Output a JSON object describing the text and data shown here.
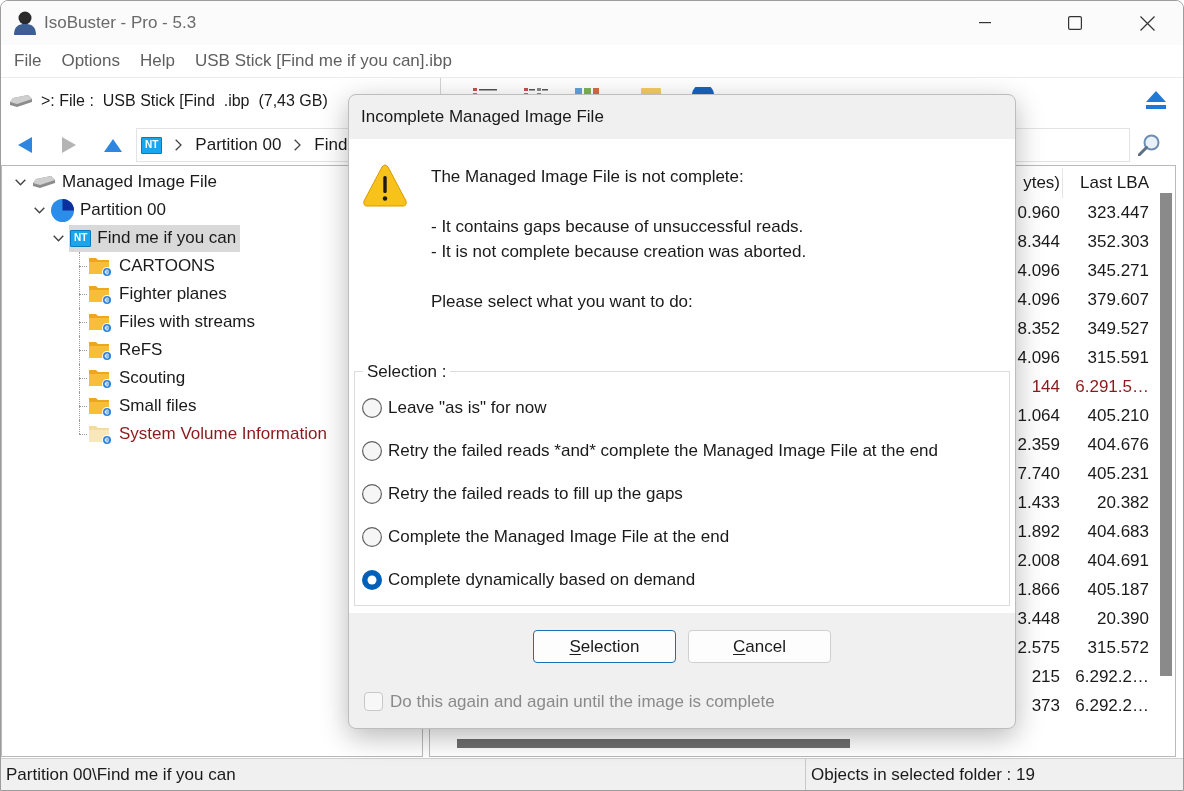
{
  "window": {
    "title": "IsoBuster - Pro - 5.3"
  },
  "menu": [
    "File",
    "Options",
    "Help",
    "USB Stick [Find me if you can].ibp"
  ],
  "toolbar": {
    "device": ">: File :  USB Stick [Find  .ibp  (7,43 GB)"
  },
  "address": {
    "badge": "NT",
    "segments": [
      "Partition 00",
      "Find"
    ]
  },
  "tree": [
    {
      "label": "Managed Image File",
      "kind": "drive",
      "expanded": true,
      "selected": false,
      "children": [
        {
          "label": "Partition 00",
          "kind": "partition",
          "expanded": true,
          "selected": false,
          "children": [
            {
              "label": "Find me if you can",
              "kind": "volume",
              "badge": "NT",
              "expanded": true,
              "selected": true,
              "children": [
                {
                  "label": "CARTOONS",
                  "kind": "folder",
                  "system": false,
                  "selected": false
                },
                {
                  "label": "Fighter planes",
                  "kind": "folder",
                  "system": false,
                  "selected": false
                },
                {
                  "label": "Files with streams",
                  "kind": "folder",
                  "system": false,
                  "selected": false
                },
                {
                  "label": "ReFS",
                  "kind": "folder",
                  "system": false,
                  "selected": false
                },
                {
                  "label": "Scouting",
                  "kind": "folder",
                  "system": false,
                  "selected": false
                },
                {
                  "label": "Small files",
                  "kind": "folder",
                  "system": false,
                  "selected": false
                },
                {
                  "label": "System Volume Information",
                  "kind": "folder",
                  "system": true,
                  "selected": false
                }
              ]
            }
          ]
        }
      ]
    }
  ],
  "list": {
    "columns": [
      "ytes)",
      "Last LBA"
    ],
    "rows": [
      {
        "cells": [
          "0.960",
          "323.447"
        ],
        "system": false
      },
      {
        "cells": [
          "8.344",
          "352.303"
        ],
        "system": false
      },
      {
        "cells": [
          "4.096",
          "345.271"
        ],
        "system": false
      },
      {
        "cells": [
          "4.096",
          "379.607"
        ],
        "system": false
      },
      {
        "cells": [
          "8.352",
          "349.527"
        ],
        "system": false
      },
      {
        "cells": [
          "4.096",
          "315.591"
        ],
        "system": false
      },
      {
        "cells": [
          "144",
          "6.291.5…"
        ],
        "system": true
      },
      {
        "cells": [
          "1.064",
          "405.210"
        ],
        "system": false
      },
      {
        "cells": [
          "2.359",
          "404.676"
        ],
        "system": false
      },
      {
        "cells": [
          "7.740",
          "405.231"
        ],
        "system": false
      },
      {
        "cells": [
          "1.433",
          "20.382"
        ],
        "system": false
      },
      {
        "cells": [
          "1.892",
          "404.683"
        ],
        "system": false
      },
      {
        "cells": [
          "2.008",
          "404.691"
        ],
        "system": false
      },
      {
        "cells": [
          "1.866",
          "405.187"
        ],
        "system": false
      },
      {
        "cells": [
          "3.448",
          "20.390"
        ],
        "system": false
      },
      {
        "cells": [
          "2.575",
          "315.572"
        ],
        "system": false
      },
      {
        "cells": [
          "215",
          "6.292.2…"
        ],
        "system": false
      },
      {
        "cells": [
          "373",
          "6.292.2…"
        ],
        "system": false
      }
    ]
  },
  "dialog": {
    "title": "Incomplete Managed Image File",
    "message": {
      "heading": "The Managed Image File is not complete:",
      "reasons": [
        "- It contains gaps because of unsuccessful reads.",
        "- It is not complete because creation was aborted."
      ],
      "prompt": "Please select what you want to do:"
    },
    "selection": {
      "label": "Selection :",
      "options": [
        {
          "label": "Leave \"as is\" for now",
          "selected": false
        },
        {
          "label": "Retry the failed reads *and* complete the Managed Image File at the end",
          "selected": false
        },
        {
          "label": "Retry the failed reads to fill up the gaps",
          "selected": false
        },
        {
          "label": "Complete the Managed Image File at the end",
          "selected": false
        },
        {
          "label": "Complete dynamically based on demand",
          "selected": true
        }
      ]
    },
    "buttons": [
      {
        "label": "Selection",
        "default": true,
        "mnemonic": true
      },
      {
        "label": "Cancel",
        "default": false,
        "mnemonic": true
      }
    ],
    "repeat": {
      "label": "Do this again and again until the image is complete",
      "checked": false,
      "disabled": true
    }
  },
  "status_bar": {
    "path": "Partition 00\\Find me if you can",
    "objects": "Objects in selected folder : 19"
  }
}
